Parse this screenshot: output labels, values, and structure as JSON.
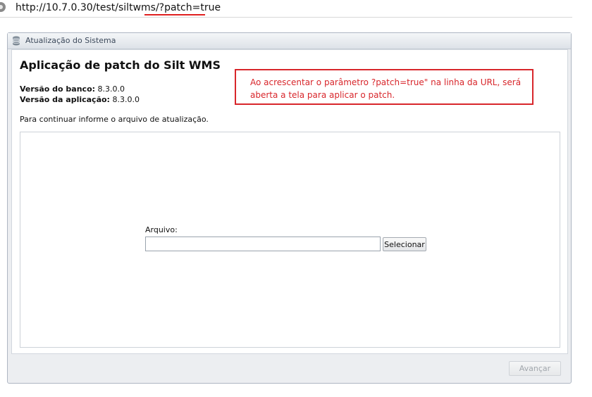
{
  "browser": {
    "url": "http://10.7.0.30/test/siltwms/?patch=true"
  },
  "panel": {
    "title": "Atualização do Sistema",
    "page_title": "Aplicação de patch do Silt WMS",
    "versions": [
      {
        "label": "Versão do banco:",
        "value": "8.3.0.0"
      },
      {
        "label": "Versão da aplicação:",
        "value": "8.3.0.0"
      }
    ],
    "instruction": "Para continuar informe o arquivo de atualização.",
    "file_field": {
      "label": "Arquivo:",
      "value": "",
      "button_label": "Selecionar"
    },
    "next_button": {
      "label": "Avançar",
      "enabled": false
    }
  },
  "annotation": {
    "text": "Ao acrescentar o parâmetro ?patch=true\" na linha da URL, será aberta a tela para aplicar o patch.",
    "color": "#d8262b"
  }
}
